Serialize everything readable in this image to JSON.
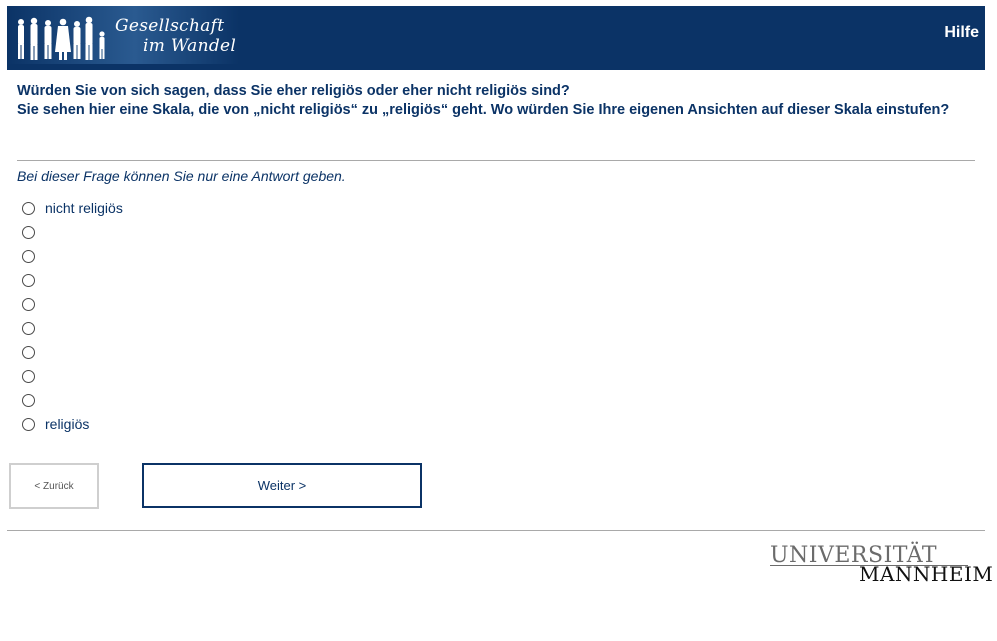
{
  "header": {
    "logo_line1": "Gesellschaft",
    "logo_line2": "im Wandel",
    "help_label": "Hilfe",
    "color": "#0b3366"
  },
  "question": {
    "line1": "Würden Sie von sich sagen, dass Sie eher religiös oder eher nicht religiös sind?",
    "line2": "Sie sehen hier eine Skala, die von „nicht religiös“ zu „religiös“ geht. Wo würden Sie Ihre eigenen Ansichten auf dieser Skala einstufen?"
  },
  "instruction": "Bei dieser Frage können Sie nur eine Antwort geben.",
  "options": [
    {
      "label": "nicht religiös"
    },
    {
      "label": ""
    },
    {
      "label": ""
    },
    {
      "label": ""
    },
    {
      "label": ""
    },
    {
      "label": ""
    },
    {
      "label": ""
    },
    {
      "label": ""
    },
    {
      "label": ""
    },
    {
      "label": "religiös"
    }
  ],
  "nav": {
    "back_label": "< Zurück",
    "next_label": "Weiter >"
  },
  "footer": {
    "uni_top": "UNIVERSITÄT",
    "uni_bottom": "MANNHEIM"
  }
}
